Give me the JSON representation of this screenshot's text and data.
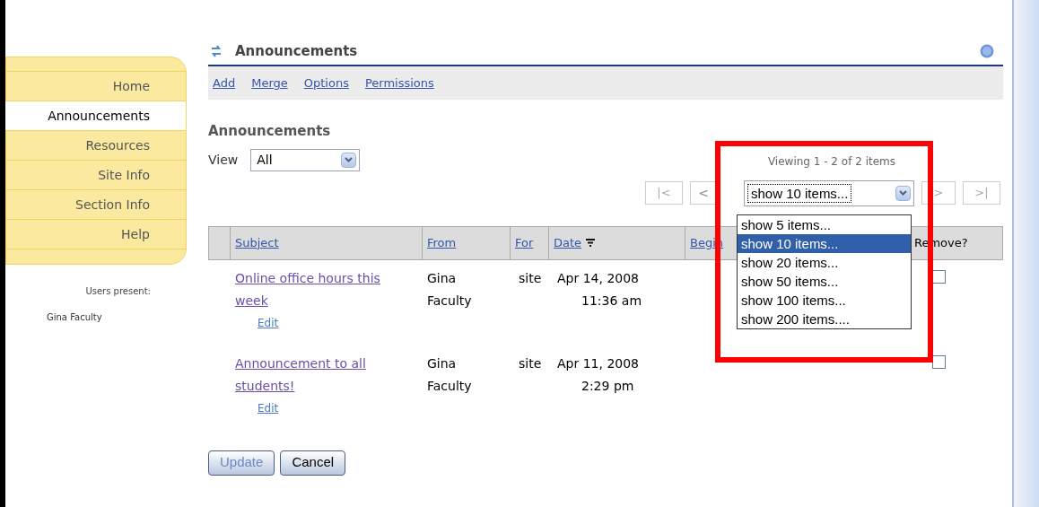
{
  "sidebar": {
    "items": [
      {
        "label": "Home",
        "selected": false
      },
      {
        "label": "Announcements",
        "selected": true
      },
      {
        "label": "Resources",
        "selected": false
      },
      {
        "label": "Site Info",
        "selected": false
      },
      {
        "label": "Section Info",
        "selected": false
      },
      {
        "label": "Help",
        "selected": false
      }
    ],
    "presence_label": "Users present:",
    "users": [
      "Gina Faculty"
    ]
  },
  "tool": {
    "title": "Announcements",
    "actions": [
      "Add",
      "Merge",
      "Options",
      "Permissions"
    ]
  },
  "heading": "Announcements",
  "view": {
    "label": "View",
    "value": "All"
  },
  "pager": {
    "summary": "Viewing 1 - 2 of 2 items",
    "first": "|<",
    "prev": "<",
    "next": ">",
    "last": ">|",
    "page_size": "show 10 items...",
    "options": [
      {
        "label": "show 5 items...",
        "selected": false
      },
      {
        "label": "show 10 items...",
        "selected": true
      },
      {
        "label": "show 20 items...",
        "selected": false
      },
      {
        "label": "show 50 items...",
        "selected": false
      },
      {
        "label": "show 100 items...",
        "selected": false
      },
      {
        "label": "show 200 items....",
        "selected": false
      }
    ]
  },
  "table": {
    "columns": [
      "Subject",
      "From",
      "For",
      "Date",
      "Begin",
      "Remove?"
    ],
    "rows": [
      {
        "subject": "Online office hours this week",
        "edit": "Edit",
        "from": "Gina Faculty",
        "for": "site",
        "date": "Apr 14, 2008",
        "time": "11:36 am",
        "checked": false
      },
      {
        "subject": "Announcement to all students!",
        "edit": "Edit",
        "from": "Gina Faculty",
        "for": "site",
        "date": "Apr 11, 2008",
        "time": "2:29 pm",
        "checked": false
      }
    ]
  },
  "buttons": [
    "Update",
    "Cancel"
  ]
}
